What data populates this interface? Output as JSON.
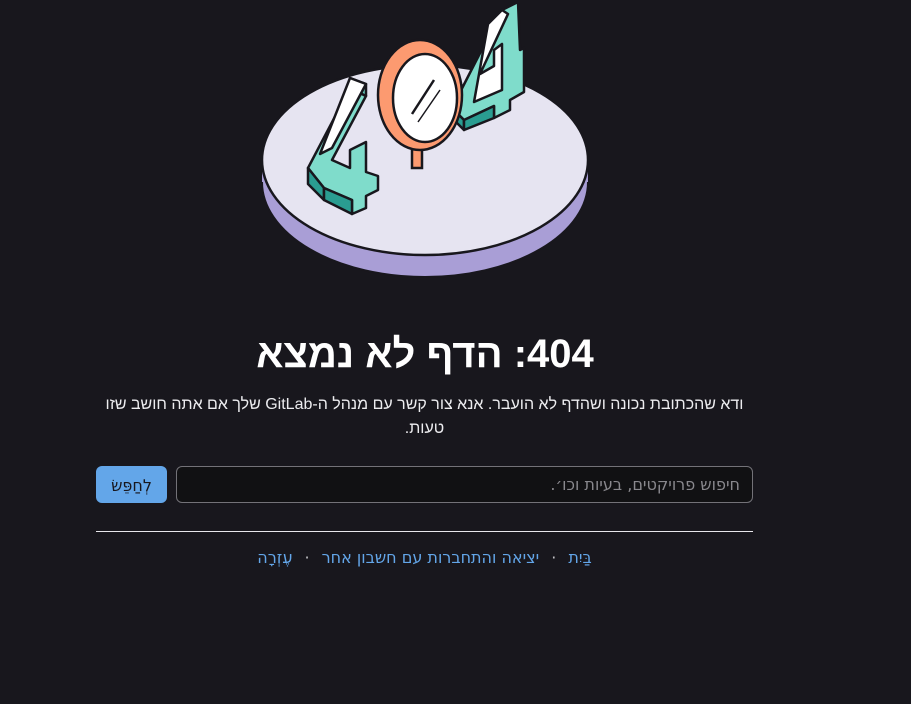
{
  "error": {
    "title": "404: הדף לא נמצא",
    "description": "ודא שהכתובת נכונה ושהדף לא הועבר. אנא צור קשר עם מנהל ה-GitLab שלך אם אתה חושב שזו טעות."
  },
  "search": {
    "placeholder": "חיפוש פרויקטים, בעיות וכו׳.",
    "button_label": "לְחַפֵּשׂ"
  },
  "footer": {
    "links": {
      "home": "בַּיִת",
      "switch_account": "יציאה והתחברות עם חשבון אחר",
      "help": "עֶזְרָה"
    },
    "separator": "·"
  },
  "colors": {
    "background": "#18171d",
    "accent": "#63a6e9",
    "teal": "#63c9b8",
    "orange": "#fc9a70",
    "platform": "#ececf7",
    "platform_side": "#a99ed6"
  },
  "icons": {
    "illustration": "404-magnifier-illustration"
  }
}
